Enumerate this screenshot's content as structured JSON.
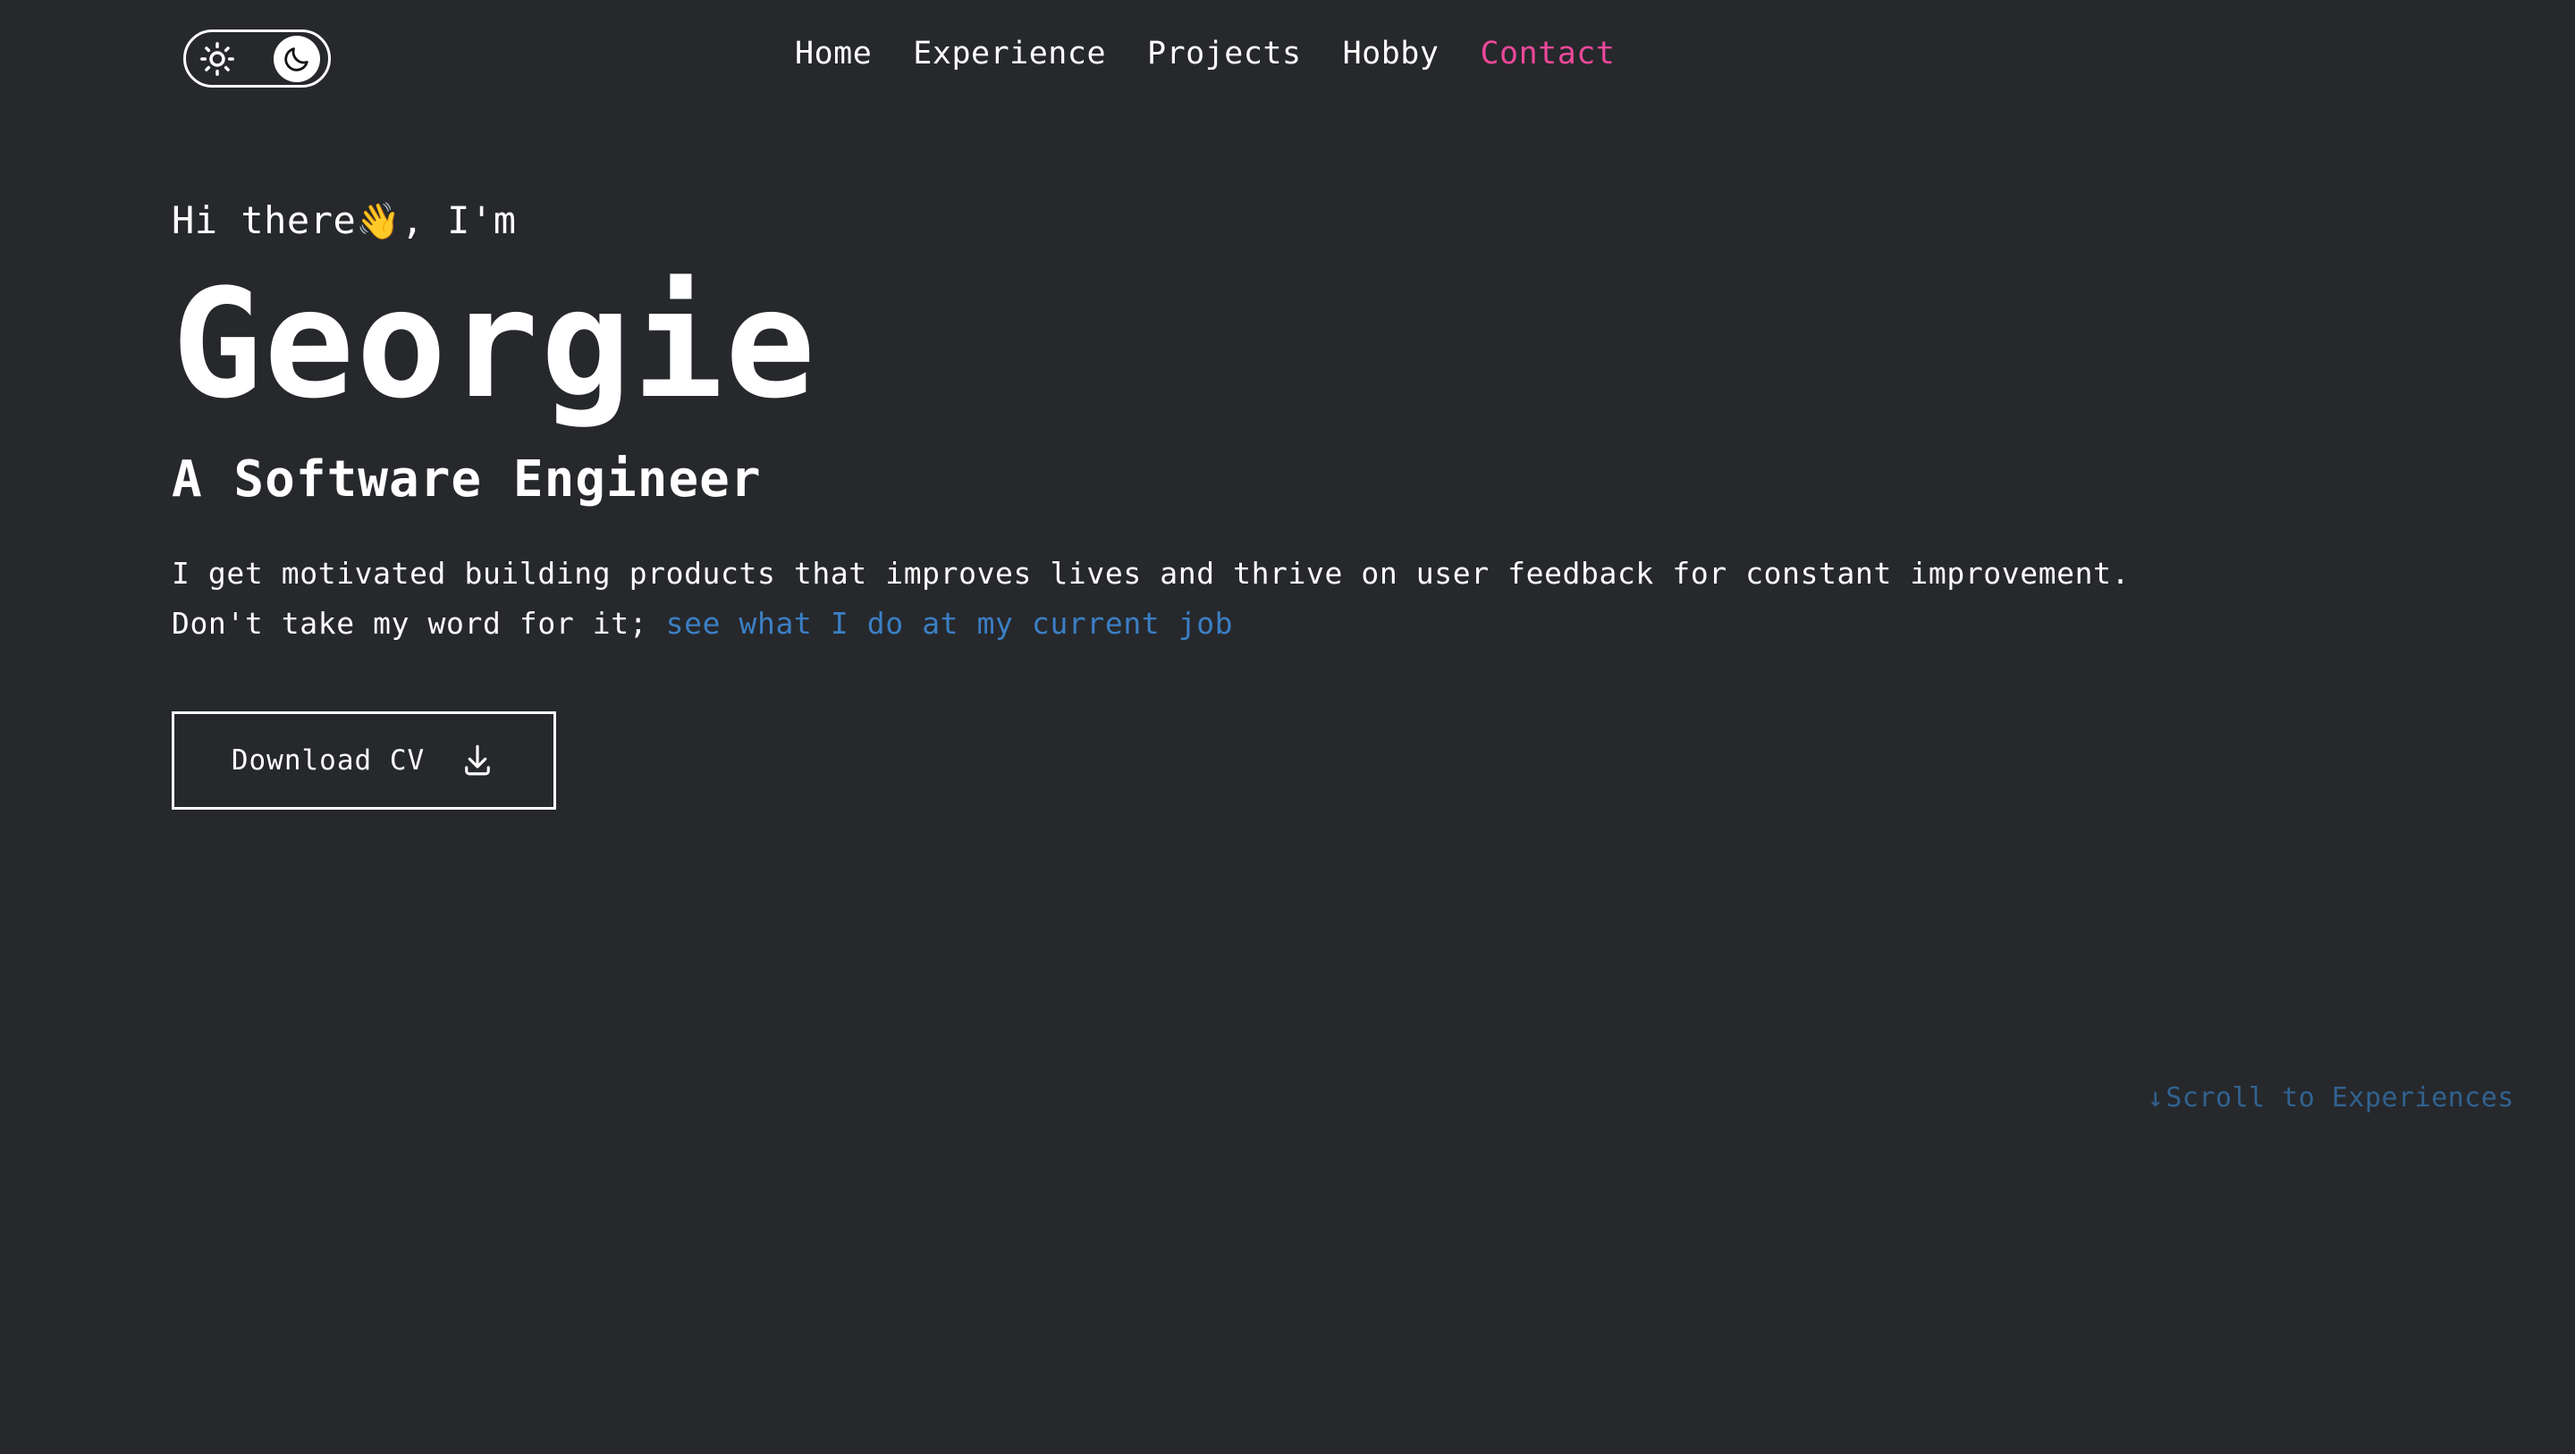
{
  "theme": {
    "background_color": "#26282c",
    "text_color": "#ffffff",
    "accent_pink": "#ec4899",
    "link_blue": "#3b7fc4",
    "scroll_cue_blue": "#31628f"
  },
  "header": {
    "theme_toggle": {
      "state": "dark",
      "light_icon": "sun-icon",
      "dark_icon": "moon-icon"
    },
    "nav": [
      {
        "label": "Home",
        "active": false
      },
      {
        "label": "Experience",
        "active": false
      },
      {
        "label": "Projects",
        "active": false
      },
      {
        "label": "Hobby",
        "active": false
      },
      {
        "label": "Contact",
        "active": true
      }
    ]
  },
  "hero": {
    "greeting_before": "Hi there",
    "greeting_emoji": "👋",
    "greeting_after": ", I'm",
    "name": "Georgie",
    "role": "A Software Engineer",
    "bio_text": "I get motivated building products that improves lives and thrive on user feedback for constant improvement. Don't take my word for it; ",
    "bio_link": "see what I do at my current job",
    "cv_button_label": "Download CV",
    "cv_button_icon": "download-icon"
  },
  "footer": {
    "scroll_arrow": "↓",
    "scroll_label": "Scroll to Experiences"
  }
}
